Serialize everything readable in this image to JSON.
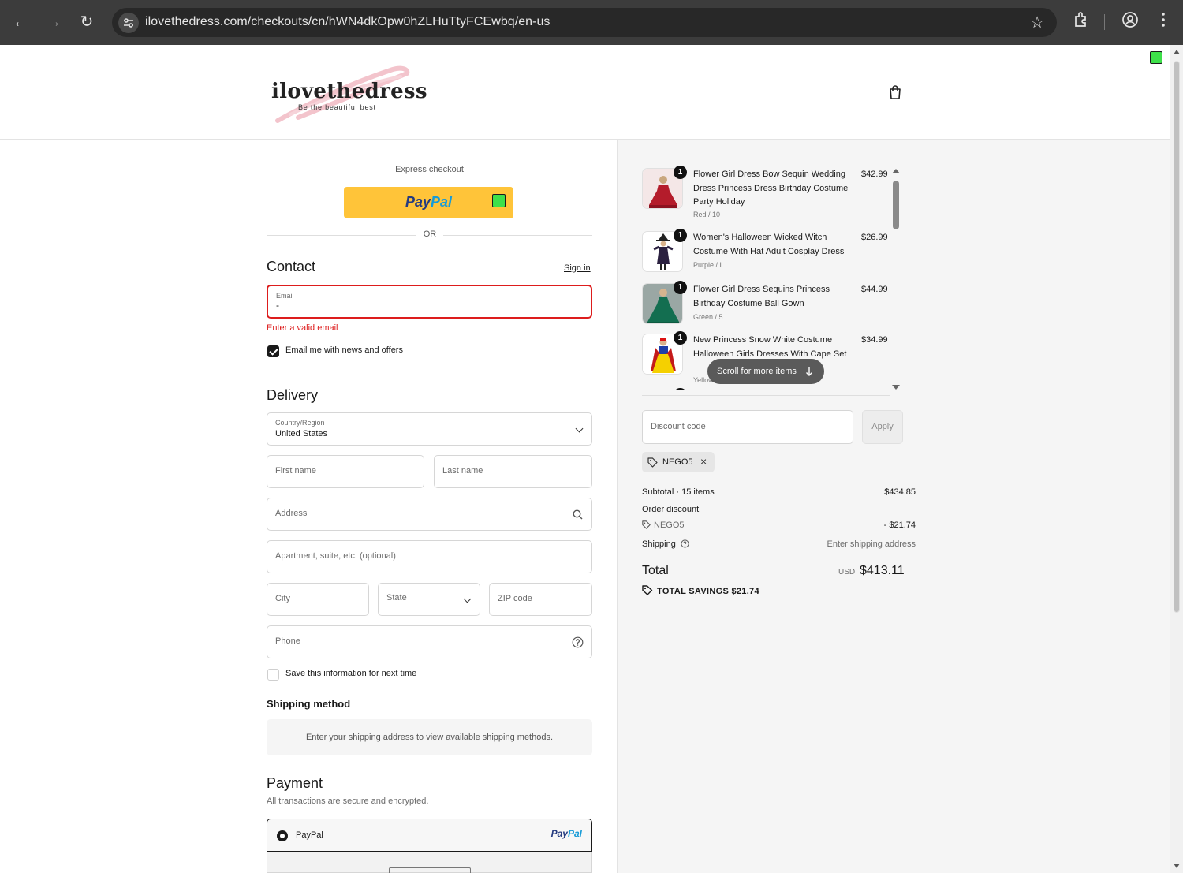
{
  "browser": {
    "url": "ilovethedress.com/checkouts/cn/hWN4dkOpw0hZLHuTtyFCEwbq/en-us"
  },
  "brand": {
    "name": "ilovethedress",
    "tagline": "Be the beautiful best"
  },
  "express": {
    "label": "Express checkout",
    "paypal_pay": "Pay",
    "paypal_pal": "Pal",
    "or": "OR"
  },
  "contact": {
    "heading": "Contact",
    "sign_in": "Sign in",
    "email_label": "Email",
    "email_value": "-",
    "error": "Enter a valid email",
    "news_label": "Email me with news and offers",
    "news_checked": true
  },
  "delivery": {
    "heading": "Delivery",
    "country_label": "Country/Region",
    "country_value": "United States",
    "first_name": "First name",
    "last_name": "Last name",
    "address": "Address",
    "apartment": "Apartment, suite, etc. (optional)",
    "city": "City",
    "state": "State",
    "zip": "ZIP code",
    "phone": "Phone",
    "save_info": "Save this information for next time"
  },
  "shipping_method": {
    "heading": "Shipping method",
    "notice": "Enter your shipping address to view available shipping methods."
  },
  "payment": {
    "heading": "Payment",
    "subtext": "All transactions are secure and encrypted.",
    "option_label": "PayPal",
    "logo_pay": "Pay",
    "logo_pal": "Pal"
  },
  "order": {
    "items": [
      {
        "qty": "1",
        "title": "Flower Girl Dress Bow Sequin Wedding Dress Princess Dress Birthday Costume Party Holiday",
        "variant": "Red / 10",
        "price": "$42.99"
      },
      {
        "qty": "1",
        "title": "Women's Halloween Wicked Witch Costume With Hat Adult Cosplay Dress",
        "variant": "Purple / L",
        "price": "$26.99"
      },
      {
        "qty": "1",
        "title": "Flower Girl Dress Sequins Princess Birthday Costume Ball Gown",
        "variant": "Green / 5",
        "price": "$44.99"
      },
      {
        "qty": "1",
        "title": "New Princess Snow White Costume Halloween Girls Dresses With Cape Set",
        "variant": "Yellow",
        "price": "$34.99"
      }
    ],
    "scroll_hint": "Scroll for more items",
    "discount_placeholder": "Discount code",
    "apply": "Apply",
    "applied_code": "NEGO5",
    "subtotal_label": "Subtotal · 15 items",
    "subtotal_value": "$434.85",
    "order_discount_label": "Order discount",
    "discount_code": "NEGO5",
    "discount_value": "- $21.74",
    "shipping_label": "Shipping",
    "shipping_value": "Enter shipping address",
    "total_label": "Total",
    "currency": "USD",
    "total_value": "$413.11",
    "savings": "TOTAL SAVINGS  $21.74"
  }
}
